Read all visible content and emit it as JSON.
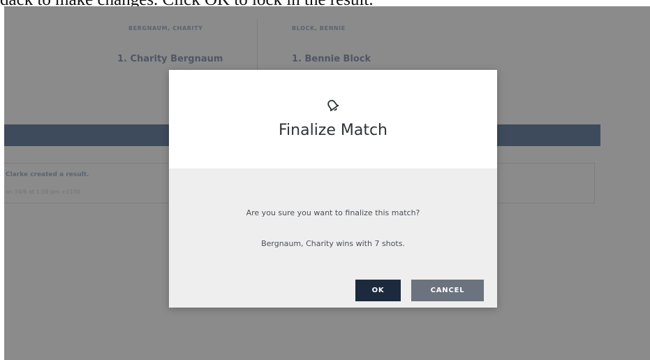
{
  "caption": "dack to make changes. Click OK to lock in the result.",
  "background": {
    "left_header": "BERGNAUM, CHARITY",
    "right_header": "BLOCK, BENNIE",
    "left_name": "1. Charity Bergnaum",
    "right_name": "1. Bennie Block",
    "log_title": "Clarke created a result.",
    "log_meta": "on 14/6 at 1:59 pm +1100"
  },
  "modal": {
    "icon": "bell-icon",
    "title": "Finalize Match",
    "question": "Are you sure you want to finalize this match?",
    "result_text": "Bergnaum, Charity wins with 7 shots.",
    "ok_label": "OK",
    "cancel_label": "CANCEL"
  },
  "colors": {
    "overlay": "#8b8b8b",
    "band": "#3d4b5c",
    "ok_button": "#1c2a3d",
    "cancel_button": "#6a737e",
    "modal_body": "#eeeeee"
  }
}
